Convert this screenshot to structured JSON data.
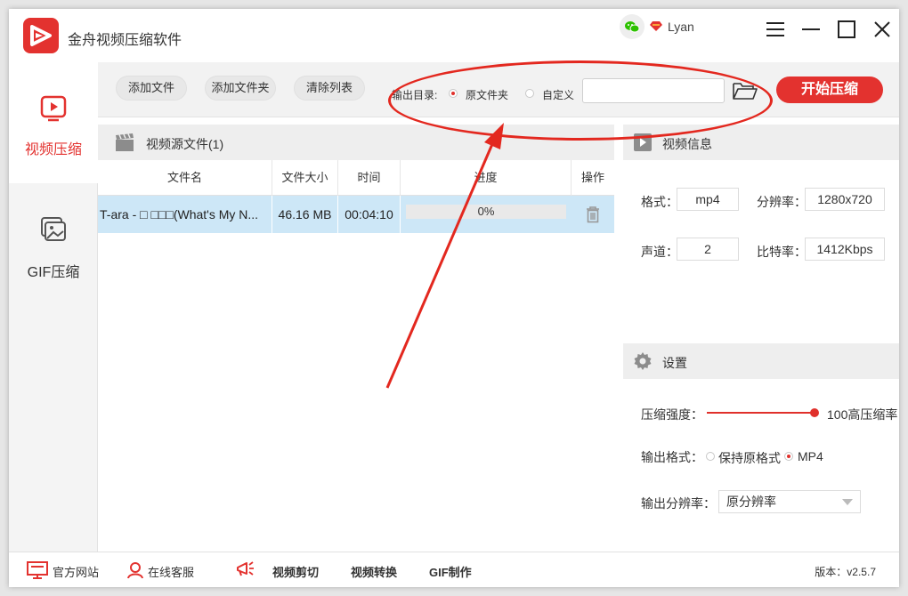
{
  "app": {
    "title": "金舟视频压缩软件",
    "username": "Lyan",
    "accent_color": "#e3322f"
  },
  "sidebar": {
    "items": [
      {
        "label": "视频压缩",
        "icon": "video-play-icon",
        "active": true
      },
      {
        "label": "GIF压缩",
        "icon": "gif-image-icon",
        "active": false
      }
    ]
  },
  "toolbar": {
    "add_file": "添加文件",
    "add_folder": "添加文件夹",
    "clear_list": "清除列表",
    "output_dir_label": "输出目录:",
    "option_original": "原文件夹",
    "option_custom": "自定义",
    "selected_option": "原文件夹",
    "custom_path_value": "",
    "start_button": "开始压缩"
  },
  "source": {
    "title": "视频源文件(1)",
    "columns": [
      "文件名",
      "文件大小",
      "时间",
      "进度",
      "操作"
    ],
    "rows": [
      {
        "name": "T-ara - □ □□□(What's My N...",
        "size": "46.16 MB",
        "duration": "00:04:10",
        "progress": 0,
        "progress_text": "0%"
      }
    ]
  },
  "video_info": {
    "title": "视频信息",
    "format_label": "格式：",
    "format_value": "mp4",
    "resolution_label": "分辨率：",
    "resolution_value": "1280x720",
    "channels_label": "声道：",
    "channels_value": "2",
    "bitrate_label": "比特率：",
    "bitrate_value": "1412Kbps"
  },
  "settings": {
    "title": "设置",
    "strength_label": "压缩强度：",
    "strength_value": 100,
    "strength_text": "100高压缩率",
    "format_label": "输出格式：",
    "format_option_keep": "保持原格式",
    "format_option_mp4": "MP4",
    "format_selected": "MP4",
    "resolution_label": "输出分辨率：",
    "resolution_selected": "原分辨率"
  },
  "statusbar": {
    "website": "官方网站",
    "support": "在线客服",
    "video_cut": "视频剪切",
    "video_convert": "视频转换",
    "gif_make": "GIF制作",
    "version": "版本：v2.5.7"
  }
}
